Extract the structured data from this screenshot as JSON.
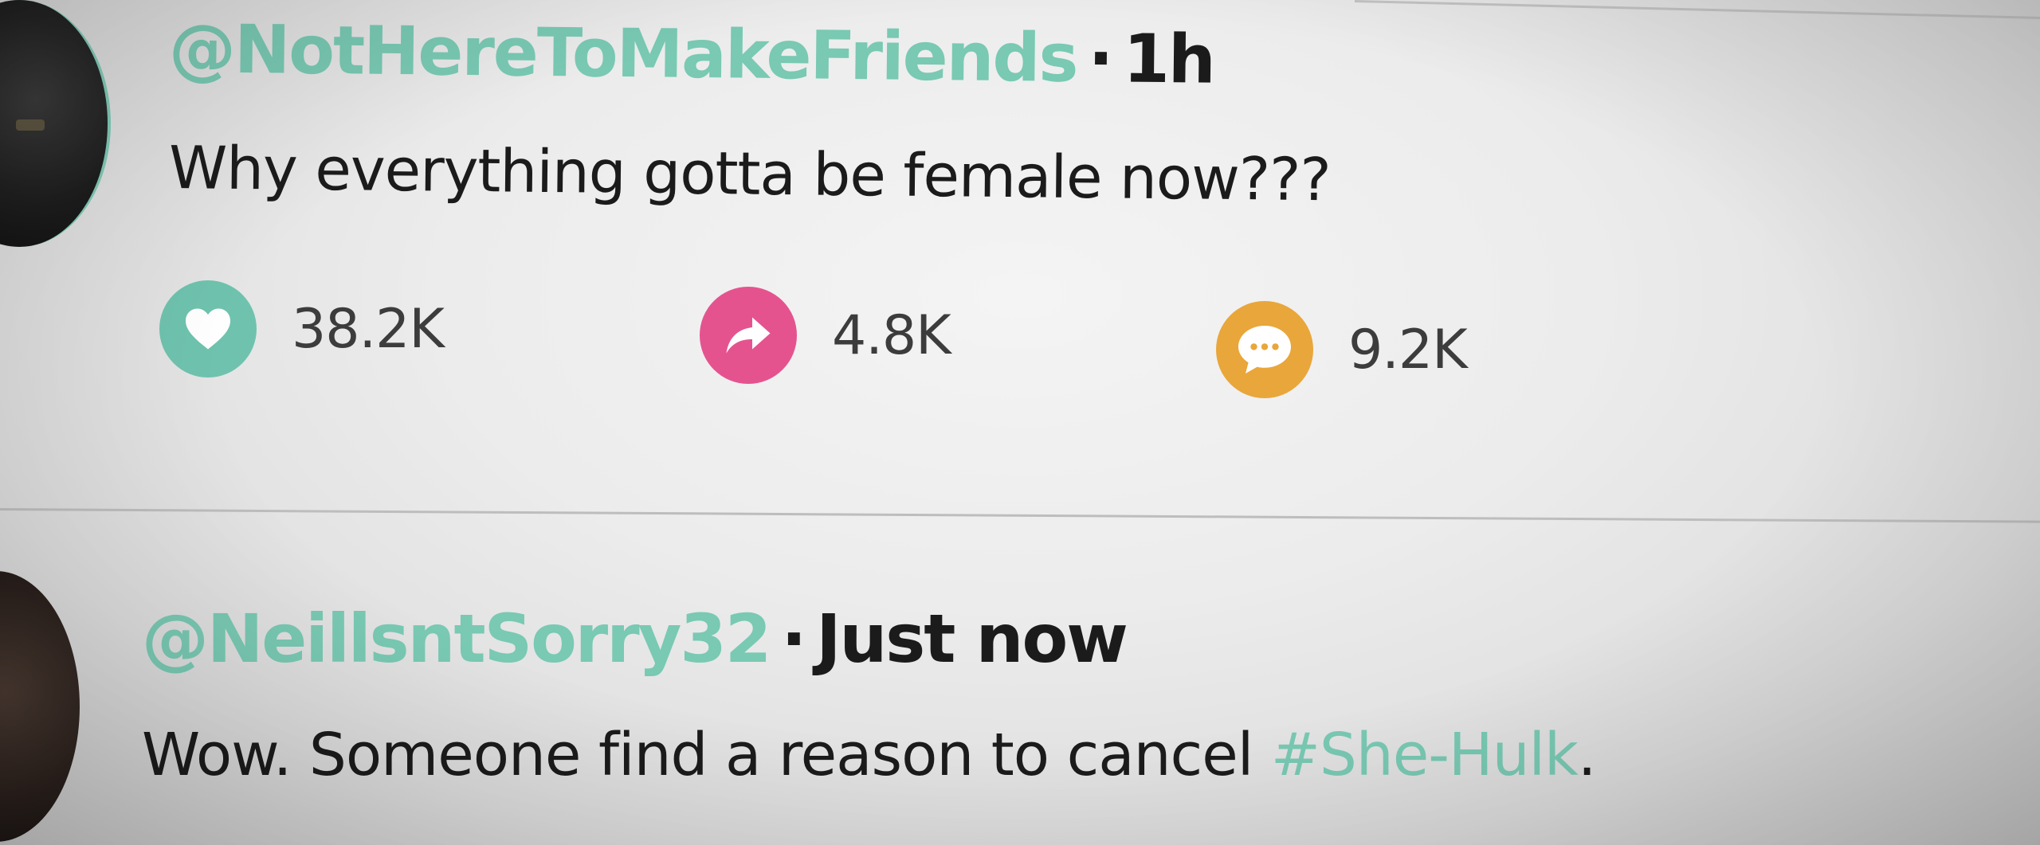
{
  "posts": [
    {
      "handle": "@NotHereToMakeFriends",
      "separator": "·",
      "time": "1h",
      "text": "Why everything gotta be female now???",
      "actions": {
        "likes": "38.2K",
        "shares": "4.8K",
        "comments": "9.2K"
      }
    },
    {
      "handle": "@NeillsntSorry32",
      "separator": "·",
      "time": "Just now",
      "text_before": "Wow. Someone find a reason to cancel ",
      "hashtag": "#She-Hulk",
      "text_after": "."
    }
  ],
  "icons": {
    "like": "heart-icon",
    "share": "share-arrow-icon",
    "comment": "speech-bubble-icon"
  },
  "colors": {
    "handle": "#79c9b3",
    "like": "#6fc3ae",
    "share": "#e5538f",
    "comment": "#e9a63a",
    "text": "#1b1b1b"
  }
}
